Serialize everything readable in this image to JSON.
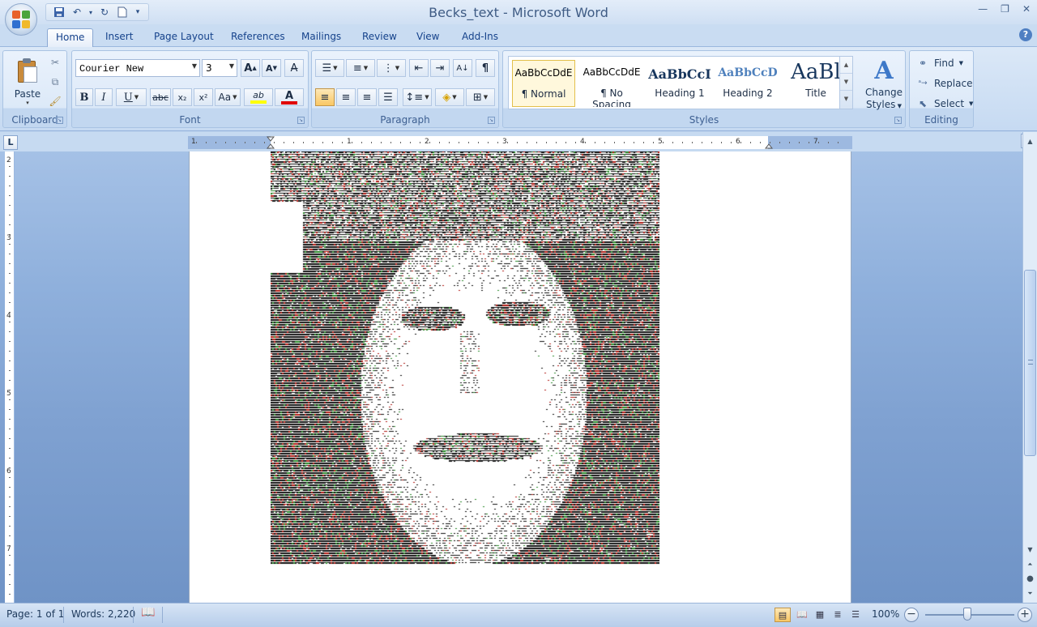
{
  "window": {
    "title": "Becks_text - Microsoft Word"
  },
  "qat": {
    "save": "save-icon",
    "undo": "undo-icon",
    "redo": "redo-icon",
    "new": "new-document-icon",
    "customize": "▾"
  },
  "tabs": [
    "Home",
    "Insert",
    "Page Layout",
    "References",
    "Mailings",
    "Review",
    "View",
    "Add-Ins"
  ],
  "active_tab": "Home",
  "ribbon": {
    "clipboard": {
      "label": "Clipboard",
      "paste": "Paste"
    },
    "font": {
      "label": "Font",
      "font_name": "Courier New",
      "font_size": "3",
      "grow": "A",
      "shrink": "A",
      "bold": "B",
      "italic": "I",
      "underline": "U",
      "strike": "abc",
      "sub": "x₂",
      "sup": "x²",
      "change_case": "Aa",
      "highlight": "ab",
      "font_color": "A",
      "highlight_color": "#ffff00",
      "font_color_bar": "#e00000"
    },
    "paragraph": {
      "label": "Paragraph",
      "pilcrow": "¶"
    },
    "styles": {
      "label": "Styles",
      "items": [
        {
          "sample": "AaBbCcDdE",
          "name": "¶ Normal"
        },
        {
          "sample": "AaBbCcDdE",
          "name": "¶ No Spacing"
        },
        {
          "sample": "AaBbCcI",
          "name": "Heading 1"
        },
        {
          "sample": "AaBbCcD",
          "name": "Heading 2"
        },
        {
          "sample": "AaBl",
          "name": "Title"
        }
      ],
      "change_styles": [
        "Change",
        "Styles"
      ]
    },
    "editing": {
      "label": "Editing",
      "find": "Find",
      "replace": "Replace",
      "select": "Select"
    }
  },
  "ruler": {
    "tab_selector": "L",
    "h_numbers": [
      "1",
      "1",
      "2",
      "3",
      "4",
      "5",
      "6",
      "7"
    ],
    "v_numbers": [
      "2",
      "3",
      "4",
      "5",
      "6",
      "7"
    ]
  },
  "status": {
    "page": "Page: 1 of 1",
    "words": "Words: 2,220",
    "zoom": "100%"
  },
  "colors": {
    "accent": "#15428b",
    "ribbon_bg": "#dbe8f7",
    "art_black": "#111111",
    "art_red": "#b21d16",
    "art_green": "#2a8a2a"
  }
}
